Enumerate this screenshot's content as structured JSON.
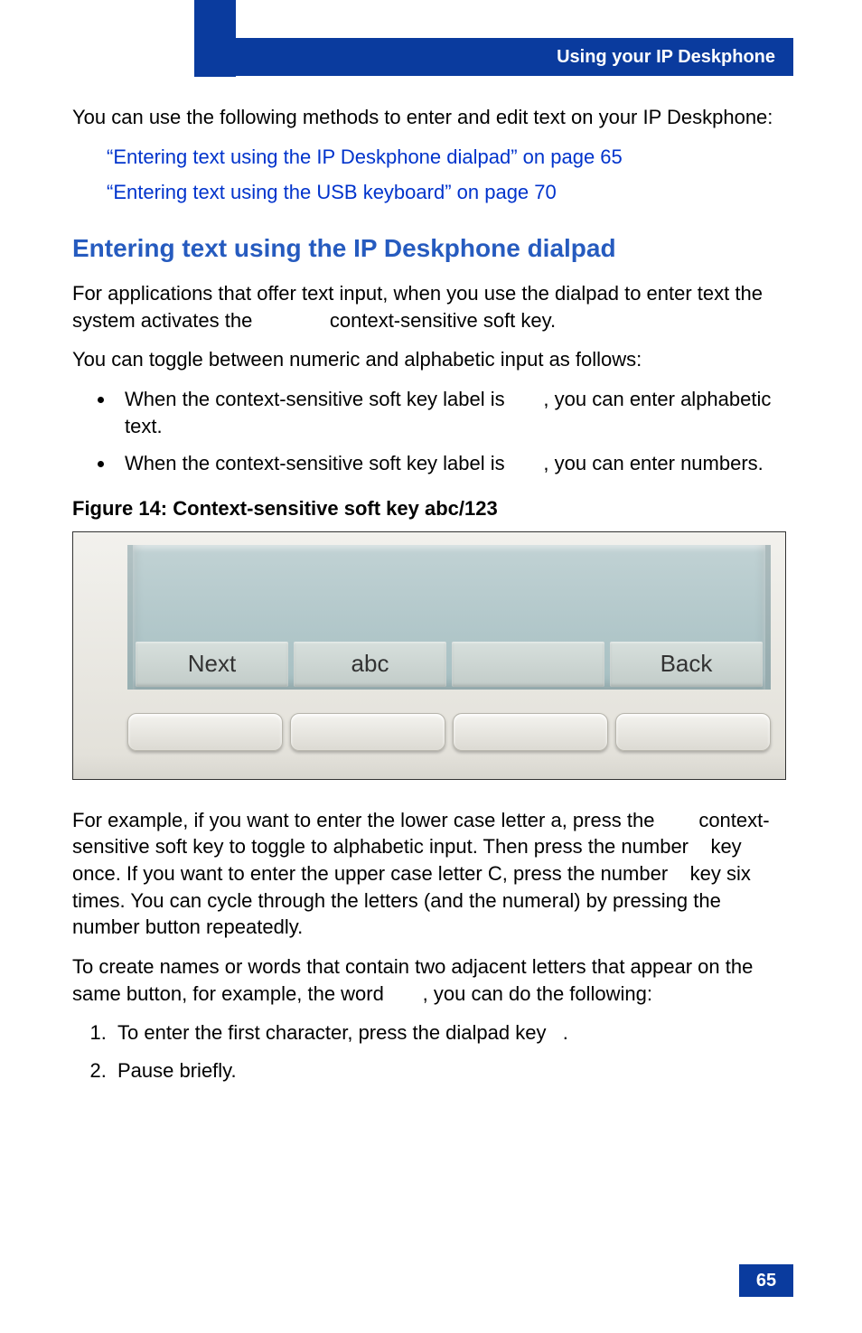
{
  "header": {
    "title": "Using your IP Deskphone"
  },
  "intro": "You can use the following methods to enter and edit text on your IP Deskphone:",
  "links": {
    "l1": "“Entering text using the IP Deskphone dialpad” on page 65",
    "l2": "“Entering text using the USB keyboard” on page 70"
  },
  "section": {
    "title": "Entering text using the IP Deskphone dialpad",
    "p1": "For applications that offer text input, when you use the dialpad to enter text the system activates the              context-sensitive soft key.",
    "p2": "You can toggle between numeric and alphabetic input as follows:",
    "b1": "When the context-sensitive soft key label is       , you can enter alphabetic text.",
    "b2": "When the context-sensitive soft key label is       , you can enter numbers."
  },
  "figure": {
    "caption": "Figure 14: Context-sensitive soft key abc/123",
    "softkeys": {
      "k1": "Next",
      "k2": "abc",
      "k3": "",
      "k4": "Back"
    }
  },
  "after_figure": {
    "p1": "For example, if you want to enter the lower case letter a, press the        context-sensitive soft key to toggle to alphabetic input. Then press the number    key once. If you want to enter the upper case letter C, press the number    key six times. You can cycle through the letters (and the numeral) by pressing the number button repeatedly.",
    "p2": "To create names or words that contain two adjacent letters that appear on the same button, for example, the word       , you can do the following:",
    "s1": "To enter the first character, press the dialpad key   .",
    "s2": "Pause briefly."
  },
  "page_number": "65"
}
